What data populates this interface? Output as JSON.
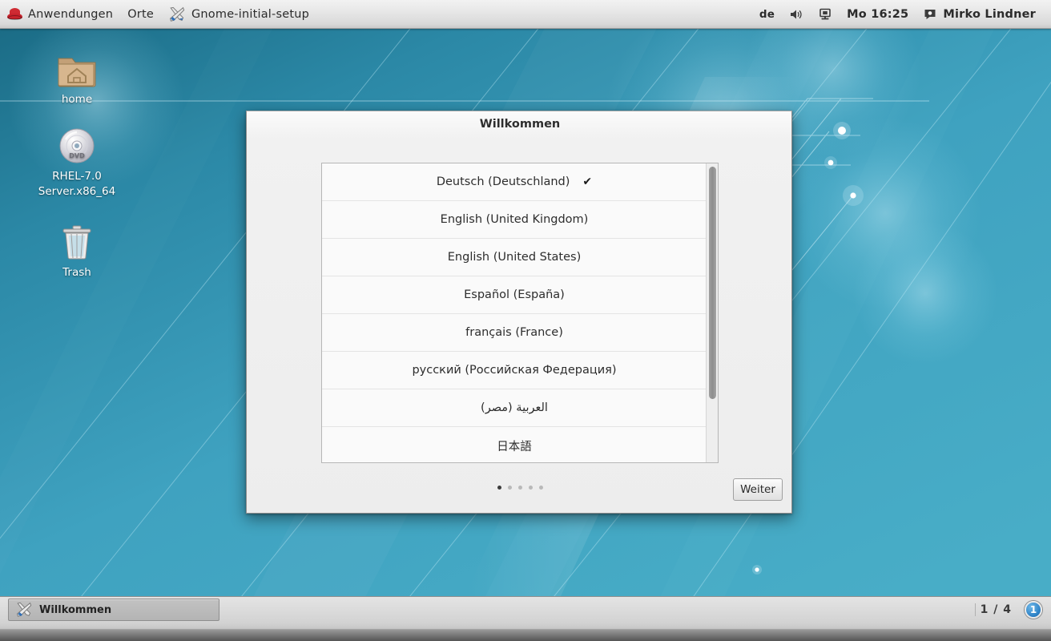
{
  "top_panel": {
    "menu_items": [
      {
        "label": "Anwendungen",
        "icon": "redhat-icon"
      },
      {
        "label": "Orte",
        "icon": null
      }
    ],
    "window_title": "Gnome-initial-setup",
    "window_icon": "tools-icon",
    "keyboard_layout": "de",
    "volume_icon": "speaker-icon",
    "display_icon": "display-icon",
    "clock": "Mo 16:25",
    "user_icon": "user-status-icon",
    "user_name": "Mirko Lindner"
  },
  "desktop": {
    "background_color": "#3ba0bd",
    "icons": [
      {
        "name": "home",
        "label": "home",
        "icon": "home-folder-icon"
      },
      {
        "name": "dvd",
        "label": "RHEL-7.0 Server.x86_64",
        "icon": "dvd-disc-icon"
      },
      {
        "name": "trash",
        "label": "Trash",
        "icon": "trash-icon"
      }
    ]
  },
  "dialog": {
    "title": "Willkommen",
    "languages": [
      {
        "label": "Deutsch (Deutschland)",
        "selected": true,
        "rtl": false
      },
      {
        "label": "English (United Kingdom)",
        "selected": false,
        "rtl": false
      },
      {
        "label": "English (United States)",
        "selected": false,
        "rtl": false
      },
      {
        "label": "Español (España)",
        "selected": false,
        "rtl": false
      },
      {
        "label": "français (France)",
        "selected": false,
        "rtl": false
      },
      {
        "label": "русский (Российская Федерация)",
        "selected": false,
        "rtl": false
      },
      {
        "label": "العربية (مصر)",
        "selected": false,
        "rtl": true
      },
      {
        "label": "日本語",
        "selected": false,
        "rtl": false
      }
    ],
    "check_glyph": "✔",
    "page_dots": {
      "count": 5,
      "active_index": 0
    },
    "next_button": "Weiter"
  },
  "bottom_panel": {
    "task_button": {
      "label": "Willkommen",
      "icon": "tools-icon"
    },
    "workspace_count": "1 / 4",
    "workspace_badge": "1"
  }
}
